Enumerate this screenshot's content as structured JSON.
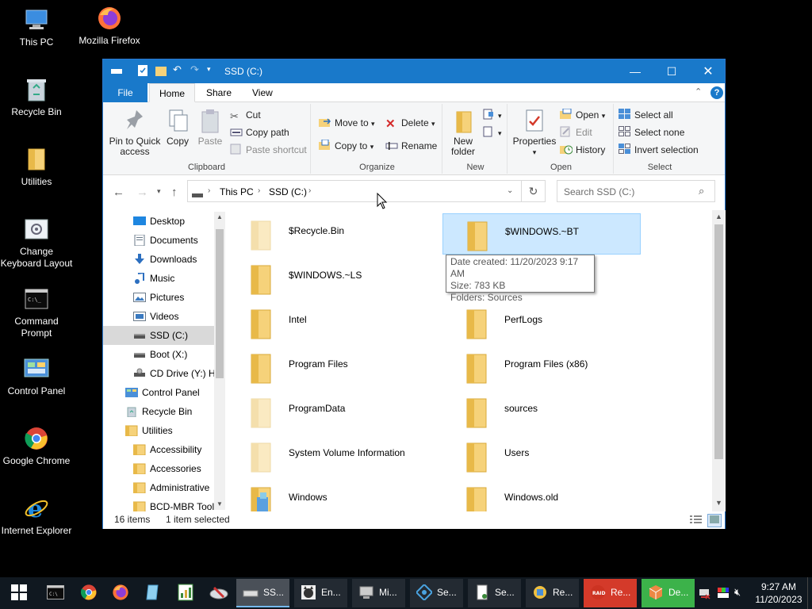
{
  "desktop_icons": [
    {
      "label": "This PC",
      "icon": "computer-icon"
    },
    {
      "label": "Mozilla Firefox",
      "icon": "firefox-icon"
    },
    {
      "label": "Recycle Bin",
      "icon": "recycle-bin-icon"
    },
    {
      "label": "Utilities",
      "icon": "folder-icon"
    },
    {
      "label": "Change Keyboard Layout",
      "icon": "keyboard-settings-icon"
    },
    {
      "label": "Command Prompt",
      "icon": "terminal-icon"
    },
    {
      "label": "Control Panel",
      "icon": "control-panel-icon"
    },
    {
      "label": "Google Chrome",
      "icon": "chrome-icon"
    },
    {
      "label": "Internet Explorer",
      "icon": "internet-explorer-icon"
    }
  ],
  "window": {
    "title": "SSD (C:)",
    "tabs": [
      "File",
      "Home",
      "Share",
      "View"
    ],
    "active_tab": "Home",
    "ribbon": {
      "clipboard": {
        "label": "Clipboard",
        "pin_to_quick_access": "Pin to Quick access",
        "copy": "Copy",
        "paste": "Paste",
        "cut": "Cut",
        "copy_path": "Copy path",
        "paste_shortcut": "Paste shortcut"
      },
      "organize": {
        "label": "Organize",
        "move_to": "Move to",
        "copy_to": "Copy to",
        "delete": "Delete",
        "rename": "Rename"
      },
      "new": {
        "label": "New",
        "new_folder": "New folder"
      },
      "open": {
        "label": "Open",
        "properties": "Properties",
        "open": "Open",
        "edit": "Edit",
        "history": "History"
      },
      "select": {
        "label": "Select",
        "select_all": "Select all",
        "select_none": "Select none",
        "invert_selection": "Invert selection"
      }
    },
    "address": {
      "crumbs": [
        "This PC",
        "SSD (C:)"
      ]
    },
    "search": {
      "placeholder": "Search SSD (C:)"
    },
    "nav_items": [
      {
        "label": "Desktop",
        "icon": "desktop-icon"
      },
      {
        "label": "Documents",
        "icon": "documents-icon"
      },
      {
        "label": "Downloads",
        "icon": "downloads-icon"
      },
      {
        "label": "Music",
        "icon": "music-icon"
      },
      {
        "label": "Pictures",
        "icon": "pictures-icon"
      },
      {
        "label": "Videos",
        "icon": "videos-icon"
      },
      {
        "label": "SSD (C:)",
        "icon": "drive-icon"
      },
      {
        "label": "Boot (X:)",
        "icon": "drive-icon"
      },
      {
        "label": "CD Drive (Y:) H",
        "icon": "cd-drive-icon"
      },
      {
        "label": "Control Panel",
        "icon": "control-panel-icon"
      },
      {
        "label": "Recycle Bin",
        "icon": "recycle-bin-icon"
      },
      {
        "label": "Utilities",
        "icon": "folder-icon"
      },
      {
        "label": "Accessibility",
        "icon": "folder-icon"
      },
      {
        "label": "Accessories",
        "icon": "folder-icon"
      },
      {
        "label": "Administrative",
        "icon": "folder-icon"
      },
      {
        "label": "BCD-MBR Tool",
        "icon": "folder-icon"
      }
    ],
    "selected_nav": "SSD (C:)",
    "files": [
      {
        "name": "$Recycle.Bin",
        "icon": "folder-icon",
        "faded": true
      },
      {
        "name": "$WINDOWS.~BT",
        "icon": "folder-icon",
        "faded": false
      },
      {
        "name": "$WINDOWS.~LS",
        "icon": "folder-icon",
        "faded": false
      },
      {
        "name": "",
        "icon": "",
        "faded": false
      },
      {
        "name": "Intel",
        "icon": "folder-icon",
        "faded": false
      },
      {
        "name": "PerfLogs",
        "icon": "folder-icon",
        "faded": false
      },
      {
        "name": "Program Files",
        "icon": "folder-icon",
        "faded": false
      },
      {
        "name": "Program Files (x86)",
        "icon": "folder-icon",
        "faded": false
      },
      {
        "name": "ProgramData",
        "icon": "folder-icon",
        "faded": true
      },
      {
        "name": "sources",
        "icon": "folder-icon",
        "faded": false
      },
      {
        "name": "System Volume Information",
        "icon": "folder-icon",
        "faded": true
      },
      {
        "name": "Users",
        "icon": "folder-icon",
        "faded": false
      },
      {
        "name": "Windows",
        "icon": "windows-folder-icon",
        "faded": false
      },
      {
        "name": "Windows.old",
        "icon": "folder-icon",
        "faded": false
      }
    ],
    "selected_file": "$WINDOWS.~BT",
    "tooltip": {
      "date_created": "Date created: 11/20/2023 9:17 AM",
      "size": "Size: 783 KB",
      "folders": "Folders: Sources"
    },
    "status": {
      "items": "16 items",
      "selected": "1 item selected"
    }
  },
  "taskbar": {
    "pinned": [
      "start-icon",
      "terminal-icon",
      "chrome-icon",
      "firefox-icon",
      "notepad-icon",
      "spreadsheet-icon",
      "disk-tool-icon"
    ],
    "apps": [
      {
        "label": "SS...",
        "icon": "drive-icon",
        "active": true
      },
      {
        "label": "En...",
        "icon": "cat-icon",
        "active": false
      },
      {
        "label": "Mi...",
        "icon": "computer-icon",
        "active": false
      },
      {
        "label": "Se...",
        "icon": "network-icon",
        "active": false
      },
      {
        "label": "Se...",
        "icon": "document-icon",
        "active": false
      },
      {
        "label": "Re...",
        "icon": "registry-icon",
        "active": false
      },
      {
        "label": "Re...",
        "icon": "raid-icon",
        "active": false,
        "color": "#d43a2a"
      },
      {
        "label": "De...",
        "icon": "cube-icon",
        "active": false,
        "color": "#3cb24a"
      }
    ],
    "time": "9:27 AM",
    "date": "11/20/2023"
  },
  "colors": {
    "titlebar": "#1979ca",
    "selection": "#cce8ff",
    "taskbar": "#101820",
    "folder": "#f6d27a"
  }
}
